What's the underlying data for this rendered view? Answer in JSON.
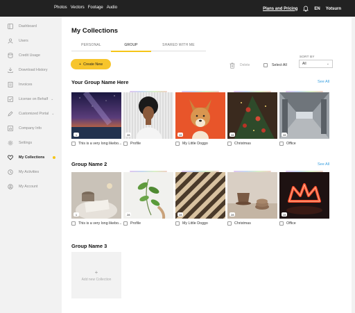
{
  "topbar": {
    "nav": [
      "Photos",
      "Vectors",
      "Footage",
      "Audio"
    ],
    "plans": "Plans and Pricing",
    "lang": "EN",
    "user": "Yotsurn"
  },
  "sidebar": {
    "items": [
      {
        "label": "Dashboard",
        "icon": "dashboard-icon"
      },
      {
        "label": "Users",
        "icon": "users-icon"
      },
      {
        "label": "Credit Usage",
        "icon": "database-icon"
      },
      {
        "label": "Download History",
        "icon": "download-icon"
      },
      {
        "label": "Invoices",
        "icon": "invoice-icon"
      },
      {
        "label": "License on Behalf",
        "icon": "license-icon"
      },
      {
        "label": "Customized Portal",
        "icon": "pen-icon"
      },
      {
        "label": "Company Info",
        "icon": "chart-icon"
      },
      {
        "label": "Settings",
        "icon": "gear-icon"
      },
      {
        "label": "My Collections",
        "icon": "heart-icon"
      },
      {
        "label": "My Activities",
        "icon": "activity-icon"
      },
      {
        "label": "My Account",
        "icon": "account-icon"
      }
    ]
  },
  "main": {
    "title": "My Collections",
    "tabs": [
      "PERSONAL",
      "GROUP",
      "SHARED WITH ME"
    ],
    "create_label": "Create New",
    "create_plus": "+",
    "delete_label": "Delete",
    "select_all_label": "Select All",
    "sort_by_label": "SORT BY",
    "sort_value": "All",
    "see_all": "See All"
  },
  "groups": [
    {
      "title": "Your Group Name Here",
      "cards": [
        {
          "name": "This is a very long likebo...",
          "count": "1"
        },
        {
          "name": "Profile",
          "count": "28"
        },
        {
          "name": "My Little Doggo",
          "count": "28"
        },
        {
          "name": "Christmas",
          "count": "28"
        },
        {
          "name": "Office",
          "count": "28"
        }
      ]
    },
    {
      "title": "Group Name 2",
      "cards": [
        {
          "name": "This is a very long likebo...",
          "count": "1"
        },
        {
          "name": "Profile",
          "count": "28"
        },
        {
          "name": "My Little Doggo",
          "count": "28"
        },
        {
          "name": "Christmas",
          "count": "28"
        },
        {
          "name": "Office",
          "count": "28"
        }
      ]
    },
    {
      "title": "Group Name 3",
      "new_label": "Add new Collection",
      "new_plus": "+"
    }
  ],
  "colors": {
    "accent": "#f7c52c",
    "link": "#3aa0e0",
    "topbar": "#222222",
    "sidebar": "#f2f2f2"
  }
}
